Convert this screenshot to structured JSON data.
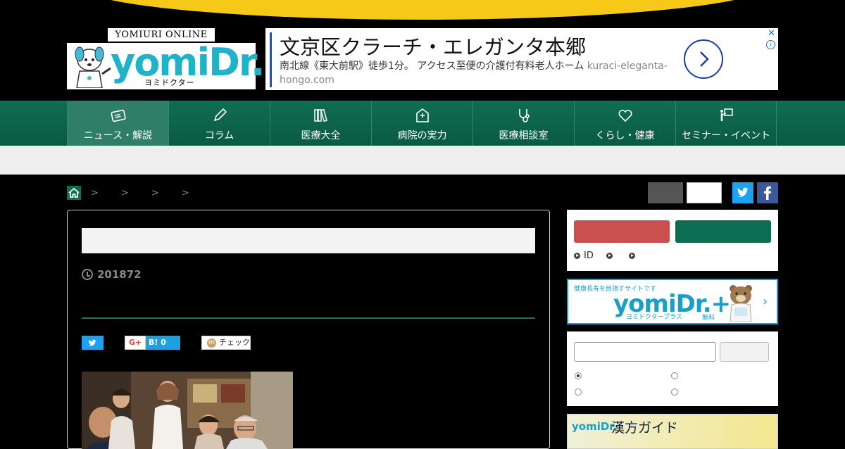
{
  "logo": {
    "publisher": "YOMIURI ONLINE",
    "brand": "yomiDr.",
    "brand_kana": "ヨミドクター"
  },
  "ad": {
    "title": "文京区クラーチ・エレガンタ本郷",
    "description": "南北線《東大前駅》徒歩1分。 アクセス至便の介護付有料老人ホーム",
    "url": "kuraci-eleganta-hongo.com",
    "close": "✕",
    "info": "i"
  },
  "nav": {
    "items": [
      {
        "label": "ニュース・解説",
        "icon": "newspaper-icon"
      },
      {
        "label": "コラム",
        "icon": "pen-icon"
      },
      {
        "label": "医療大全",
        "icon": "books-icon"
      },
      {
        "label": "病院の実力",
        "icon": "hospital-icon"
      },
      {
        "label": "医療相談室",
        "icon": "stethoscope-icon"
      },
      {
        "label": "くらし・健康",
        "icon": "heart-icon"
      },
      {
        "label": "セミナー・イベント",
        "icon": "presentation-icon"
      }
    ]
  },
  "breadcrumb": {
    "separators": [
      ">",
      ">",
      ">",
      ">"
    ]
  },
  "article": {
    "date": "201872"
  },
  "share": {
    "gplus": "G+",
    "hatena": "B!",
    "hatena_count": "0",
    "mixi_icon": "m",
    "mixi": "チェック"
  },
  "login": {
    "links": [
      "ID",
      "",
      ""
    ]
  },
  "promo": {
    "tagline": "健康長寿を目指すサイトです",
    "brand": "yomiDr.+",
    "brand_kana": "ヨミドクタープラス",
    "free": "無料",
    "arrow": "›"
  },
  "kampo": {
    "brand": "yomiDr.",
    "title": "漢方ガイド"
  },
  "colors": {
    "nav_green": "#0f6e52",
    "accent_yellow": "#f6c918",
    "login_red": "#c9504e",
    "brand_cyan": "#1aa0c8"
  }
}
